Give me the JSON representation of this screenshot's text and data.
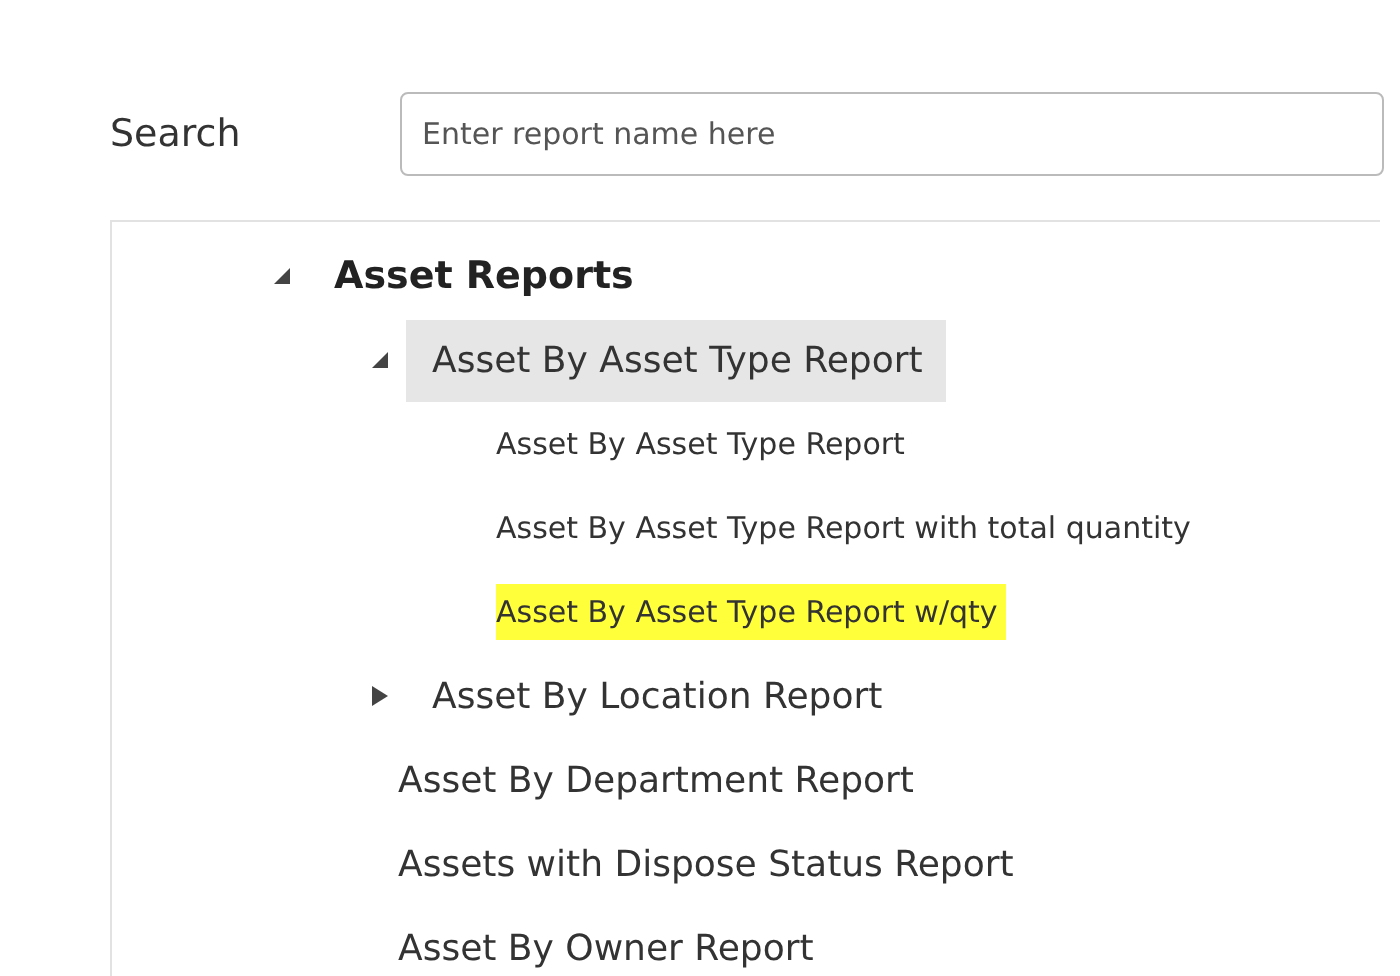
{
  "search": {
    "label": "Search",
    "placeholder": "Enter report name here"
  },
  "tree": [
    {
      "label": "Asset Reports",
      "expanded": true,
      "selected": false,
      "children": [
        {
          "label": "Asset By Asset Type Report",
          "expanded": true,
          "selected": true,
          "children": [
            {
              "label": "Asset By Asset Type Report",
              "selected": false,
              "highlighted": false
            },
            {
              "label": "Asset By Asset Type Report with total quantity",
              "selected": false,
              "highlighted": false
            },
            {
              "label": "Asset By Asset Type Report w/qty",
              "selected": false,
              "highlighted": true
            }
          ]
        },
        {
          "label": "Asset By Location Report",
          "expanded": false,
          "selected": false
        },
        {
          "label": "Asset By Department Report",
          "selected": false
        },
        {
          "label": "Assets with Dispose Status Report",
          "selected": false
        },
        {
          "label": "Asset By Owner Report",
          "selected": false
        }
      ]
    }
  ]
}
